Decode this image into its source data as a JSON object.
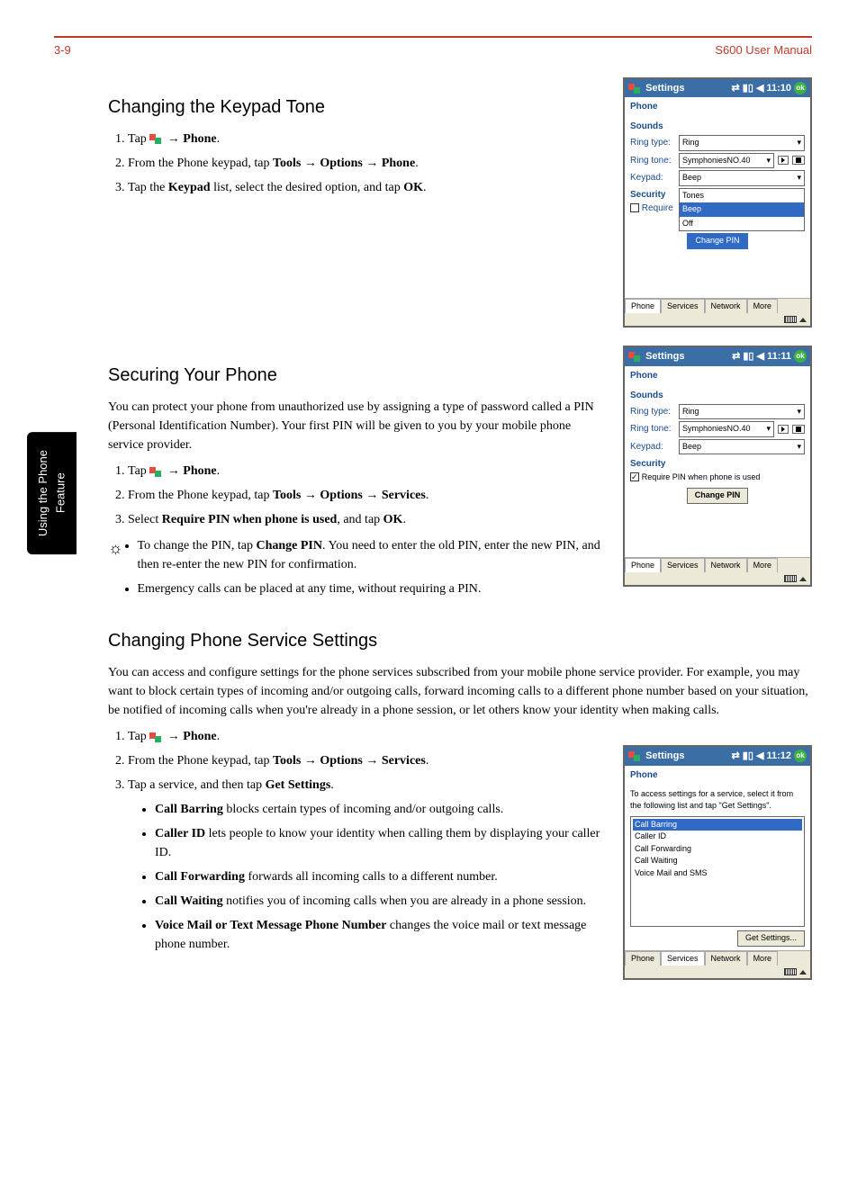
{
  "header": {
    "page_ref": "3-9",
    "manual_title": "S600 User Manual"
  },
  "side_tab": {
    "line1": "Using the Phone",
    "line2": "Feature"
  },
  "section1": {
    "title": "Changing the Keypad Tone",
    "step1_a": "Tap ",
    "step1_b": " → ",
    "step1_phone": "Phone",
    "step1_c": ".",
    "step2_a": "From the Phone keypad, tap ",
    "step2_tools": "Tools",
    "step2_arrow1": " → ",
    "step2_options": "Options",
    "step2_arrow2": " → ",
    "step2_phone": "Phone",
    "step2_end": ".",
    "step3_a": "Tap the ",
    "step3_keypad": "Keypad",
    "step3_b": " list, select the desired option, and tap ",
    "step3_ok": "OK",
    "step3_c": "."
  },
  "shot1": {
    "title": "Settings",
    "time": "11:10",
    "ok": "ok",
    "sub": "Phone",
    "sounds": "Sounds",
    "ring_type_lbl": "Ring type:",
    "ring_type_val": "Ring",
    "ring_tone_lbl": "Ring tone:",
    "ring_tone_val": "SymphoniesNO.40",
    "keypad_lbl": "Keypad:",
    "keypad_val": "Beep",
    "security": "Security",
    "require": "Require",
    "opt_tones": "Tones",
    "opt_beep": "Beep",
    "opt_off": "Off",
    "change_pin": "Change PIN",
    "tab_phone": "Phone",
    "tab_services": "Services",
    "tab_network": "Network",
    "tab_more": "More"
  },
  "section2": {
    "title": "Securing Your Phone",
    "intro": "You can protect your phone from unauthorized use by assigning a type of password called a PIN (Personal Identification Number). Your first PIN will be given to you by your mobile phone service provider.",
    "step1_a": "Tap ",
    "step1_b": " → ",
    "step1_phone": "Phone",
    "step1_c": ".",
    "step2_a": "From the Phone keypad, tap ",
    "step2_tools": "Tools",
    "step2_arrow1": " → ",
    "step2_options": "Options",
    "step2_arrow2": " → ",
    "step2_services": "Services",
    "step2_end": ".",
    "step3_a": "Select ",
    "step3_req": "Require PIN when phone is used",
    "step3_b": ", and tap ",
    "step3_ok": "OK",
    "step3_c": ".",
    "tip1_a": "To change the PIN, tap ",
    "tip1_change": "Change PIN",
    "tip1_b": ". You need to enter the old PIN, enter the new PIN, and then re-enter the new PIN for confirmation.",
    "tip2": "Emergency calls can be placed at any time, without requiring a PIN."
  },
  "shot2": {
    "title": "Settings",
    "time": "11:11",
    "ok": "ok",
    "sub": "Phone",
    "sounds": "Sounds",
    "ring_type_lbl": "Ring type:",
    "ring_type_val": "Ring",
    "ring_tone_lbl": "Ring tone:",
    "ring_tone_val": "SymphoniesNO.40",
    "keypad_lbl": "Keypad:",
    "keypad_val": "Beep",
    "security": "Security",
    "require_pin": "Require PIN when phone is used",
    "change_pin": "Change PIN",
    "tab_phone": "Phone",
    "tab_services": "Services",
    "tab_network": "Network",
    "tab_more": "More"
  },
  "section3": {
    "title": "Changing Phone Service Settings",
    "intro": "You can access and configure settings for the phone services subscribed from your mobile phone service provider. For example, you may want to block certain types of incoming and/or outgoing calls, forward incoming calls to a different phone number based on your situation, be notified of incoming calls when you're already in a phone session, or let others know your identity when making calls.",
    "step1_a": "Tap ",
    "step1_b": " → ",
    "step1_phone": "Phone",
    "step1_c": ".",
    "step2_a": "From the Phone keypad, tap ",
    "step2_tools": "Tools",
    "step2_arrow1": " → ",
    "step2_options": "Options",
    "step2_arrow2": " → ",
    "step2_services": "Services",
    "step2_end": ".",
    "step3_a": "Tap a service, and then tap ",
    "step3_get": "Get Settings",
    "step3_b": ".",
    "cb_name": "Call Barring",
    "cb_desc": "  blocks certain types of incoming and/or outgoing calls.",
    "cid_name": "Caller ID",
    "cid_desc": "  lets people to know your identity when calling them by displaying your caller ID.",
    "cf_name": "Call Forwarding",
    "cf_desc": "  forwards all incoming calls to a different number.",
    "cw_name": "Call Waiting",
    "cw_desc": "  notifies you of incoming calls when you are already in a phone session.",
    "vm_name": "Voice Mail or Text Message Phone Number",
    "vm_desc": "  changes the voice mail or text message phone number."
  },
  "shot3": {
    "title": "Settings",
    "time": "11:12",
    "ok": "ok",
    "sub": "Phone",
    "info": "To access settings for a service, select it from the following list and tap \"Get Settings\".",
    "item1": "Call Barring",
    "item2": "Caller ID",
    "item3": "Call Forwarding",
    "item4": "Call Waiting",
    "item5": "Voice Mail and SMS",
    "get_btn": "Get Settings...",
    "tab_phone": "Phone",
    "tab_services": "Services",
    "tab_network": "Network",
    "tab_more": "More"
  }
}
